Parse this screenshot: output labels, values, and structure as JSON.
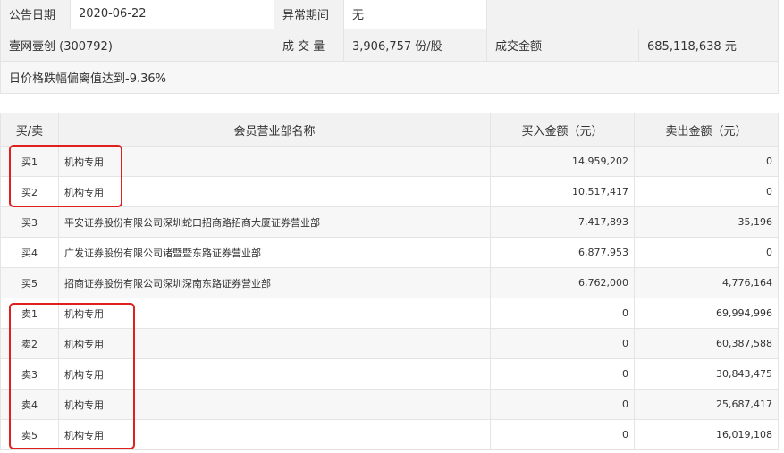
{
  "info": {
    "date_label": "公告日期",
    "date_value": "2020-06-22",
    "period_label": "异常期间",
    "period_value": "无",
    "stock": "壹网壹创 (300792)",
    "volume_label": "成 交 量",
    "volume_value": "3,906,757 份/股",
    "amount_label": "成交金额",
    "amount_value": "685,118,638 元",
    "reason": "日价格跌幅偏离值达到-9.36%"
  },
  "trade": {
    "headers": {
      "side": "买/卖",
      "name": "会员营业部名称",
      "buy": "买入金额（元）",
      "sell": "卖出金额（元）"
    },
    "rows": [
      {
        "side": "买1",
        "name": "机构专用",
        "buy": "14,959,202",
        "sell": "0"
      },
      {
        "side": "买2",
        "name": "机构专用",
        "buy": "10,517,417",
        "sell": "0"
      },
      {
        "side": "买3",
        "name": "平安证券股份有限公司深圳蛇口招商路招商大厦证券营业部",
        "buy": "7,417,893",
        "sell": "35,196"
      },
      {
        "side": "买4",
        "name": "广发证券股份有限公司诸暨暨东路证券营业部",
        "buy": "6,877,953",
        "sell": "0"
      },
      {
        "side": "买5",
        "name": "招商证券股份有限公司深圳深南东路证券营业部",
        "buy": "6,762,000",
        "sell": "4,776,164"
      },
      {
        "side": "卖1",
        "name": "机构专用",
        "buy": "0",
        "sell": "69,994,996"
      },
      {
        "side": "卖2",
        "name": "机构专用",
        "buy": "0",
        "sell": "60,387,588"
      },
      {
        "side": "卖3",
        "name": "机构专用",
        "buy": "0",
        "sell": "30,843,475"
      },
      {
        "side": "卖4",
        "name": "机构专用",
        "buy": "0",
        "sell": "25,687,417"
      },
      {
        "side": "卖5",
        "name": "机构专用",
        "buy": "0",
        "sell": "16,019,108"
      }
    ]
  },
  "colors": {
    "highlight_box": "#e0201e",
    "header_bg": "#f2f2f2",
    "border": "#e4e4e4"
  }
}
